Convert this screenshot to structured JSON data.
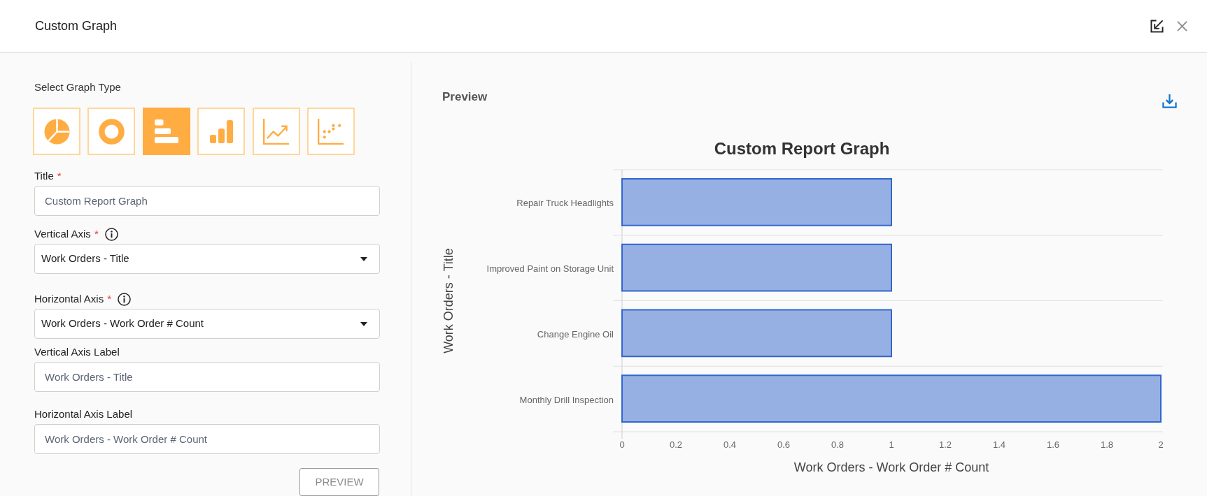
{
  "dialog": {
    "title": "Custom Graph"
  },
  "form": {
    "graph_type_label": "Select Graph Type",
    "graph_types": [
      {
        "kind": "pie",
        "selected": false
      },
      {
        "kind": "donut",
        "selected": false
      },
      {
        "kind": "horizontal_bar",
        "selected": true
      },
      {
        "kind": "column",
        "selected": false
      },
      {
        "kind": "line",
        "selected": false
      },
      {
        "kind": "scatter",
        "selected": false
      }
    ],
    "fields": [
      {
        "kind": "text",
        "label": "Title",
        "required_mark": "*",
        "info": false,
        "value": "Custom Report Graph"
      },
      {
        "kind": "select",
        "label": "Vertical Axis",
        "required_mark": "*",
        "info": true,
        "value": "Work Orders - Title"
      },
      {
        "kind": "select",
        "label": "Horizontal Axis",
        "required_mark": "*",
        "info": true,
        "value": "Work Orders - Work Order # Count"
      },
      {
        "kind": "text",
        "label": "Vertical Axis Label",
        "info": false,
        "value": "Work Orders - Title"
      },
      {
        "kind": "text",
        "label": "Horizontal Axis Label",
        "info": false,
        "value": "Work Orders - Work Order # Count"
      }
    ],
    "preview_button": "PREVIEW"
  },
  "preview": {
    "heading": "Preview",
    "chart_data": {
      "type": "bar",
      "orientation": "horizontal",
      "title": "Custom Report Graph",
      "xlabel": "Work Orders - Work Order # Count",
      "ylabel": "Work Orders - Title",
      "categories": [
        "Repair Truck Headlights",
        "Improved Paint on Storage Unit",
        "Change Engine Oil",
        "Monthly Drill Inspection"
      ],
      "values": [
        1,
        1,
        1,
        2
      ],
      "xlim": [
        0,
        2
      ],
      "xticks": [
        0,
        0.2,
        0.4,
        0.6,
        0.8,
        1,
        1.2,
        1.4,
        1.6,
        1.8,
        2
      ]
    }
  }
}
